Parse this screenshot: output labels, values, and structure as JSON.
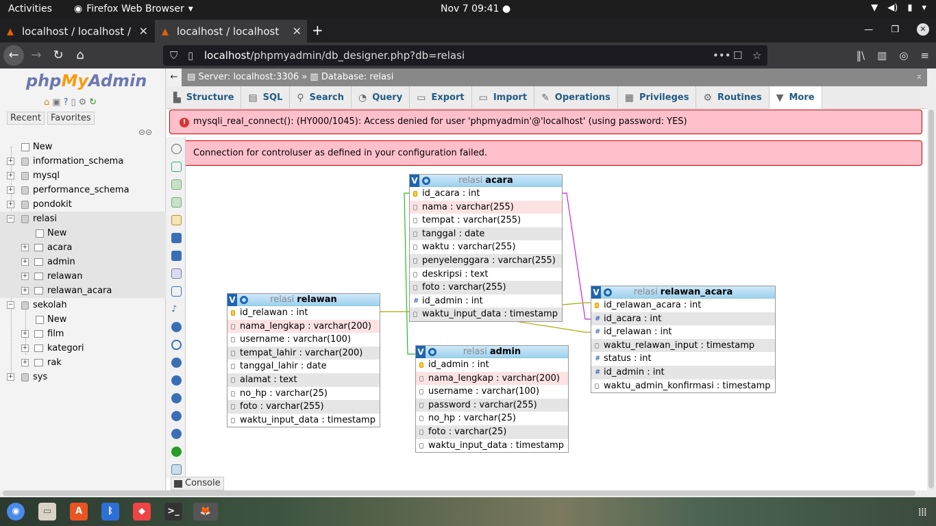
{
  "topbar": {
    "activities": "Activities",
    "app_name": "Firefox Web Browser",
    "clock": "Nov 7  09:41"
  },
  "browser": {
    "tabs": [
      {
        "title": "localhost / localhost / po"
      },
      {
        "title": "localhost / localhost / rel"
      }
    ],
    "url_host": "localhost",
    "url_path": "/phpmyadmin/db_designer.php?db=relasi"
  },
  "sidebar": {
    "logo_php": "php",
    "logo_my": "My",
    "logo_admin": "Admin",
    "recent": "Recent",
    "favorites": "Favorites",
    "tree": {
      "new_root": "New",
      "dbs": [
        "information_schema",
        "mysql",
        "performance_schema",
        "pondokit"
      ],
      "relasi": "relasi",
      "relasi_new": "New",
      "relasi_tables": [
        "acara",
        "admin",
        "relawan",
        "relawan_acara"
      ],
      "sekolah": "sekolah",
      "sekolah_new": "New",
      "sekolah_tables": [
        "film",
        "kategori",
        "rak"
      ],
      "sys": "sys"
    }
  },
  "main": {
    "breadcrumb_server": "Server: localhost:3306",
    "breadcrumb_sep": "»",
    "breadcrumb_db": "Database: relasi",
    "tabs": [
      "Structure",
      "SQL",
      "Search",
      "Query",
      "Export",
      "Import",
      "Operations",
      "Privileges",
      "Routines",
      "More"
    ],
    "error1": "mysqli_real_connect(): (HY000/1045): Access denied for user 'phpmyadmin'@'localhost' (using password: YES)",
    "error2": "Connection for controluser as defined in your configuration failed.",
    "console": "Console"
  },
  "designer": {
    "db_label": "relasi",
    "v": "V",
    "tables": {
      "acara": {
        "name": "acara",
        "columns": [
          "id_acara : int",
          "nama : varchar(255)",
          "tempat : varchar(255)",
          "tanggal : date",
          "waktu : varchar(255)",
          "penyelenggara : varchar(255)",
          "deskripsi : text",
          "foto : varchar(255)",
          "id_admin : int",
          "waktu_input_data : timestamp"
        ]
      },
      "relawan": {
        "name": "relawan",
        "columns": [
          "id_relawan : int",
          "nama_lengkap : varchar(200)",
          "username : varchar(100)",
          "tempat_lahir : varchar(200)",
          "tanggal_lahir : date",
          "alamat : text",
          "no_hp : varchar(25)",
          "foto : varchar(255)",
          "waktu_input_data : timestamp"
        ]
      },
      "admin": {
        "name": "admin",
        "columns": [
          "id_admin : int",
          "nama_lengkap : varchar(200)",
          "username : varchar(100)",
          "password : varchar(255)",
          "no_hp : varchar(25)",
          "foto : varchar(25)",
          "waktu_input_data : timestamp"
        ]
      },
      "relawan_acara": {
        "name": "relawan_acara",
        "columns": [
          "id_relawan_acara : int",
          "id_acara : int",
          "id_relawan : int",
          "waktu_relawan_input : timestamp",
          "status : int",
          "id_admin : int",
          "waktu_admin_konfirmasi : timestamp"
        ]
      }
    }
  },
  "colors": {
    "error_bg": "#ffc0cb",
    "link": "#235a81",
    "rel_green": "#22bb22",
    "rel_magenta": "#cc22cc",
    "rel_olive": "#a8a800"
  }
}
